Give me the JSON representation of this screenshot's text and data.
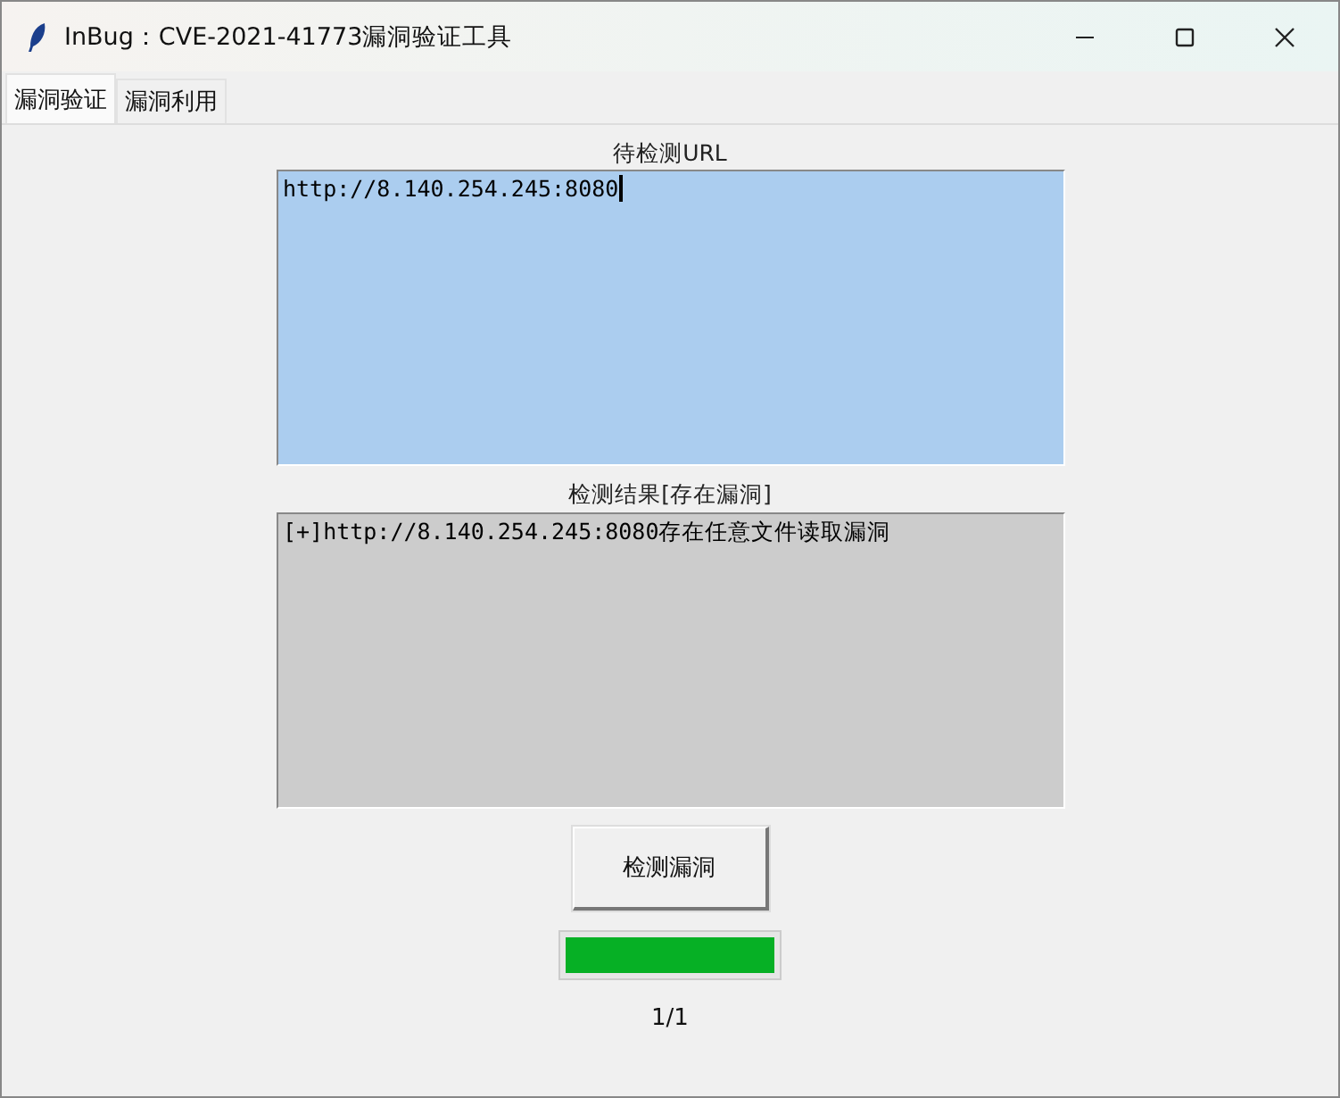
{
  "window": {
    "title": "InBug：CVE-2021-41773漏洞验证工具"
  },
  "tabs": [
    {
      "label": "漏洞验证",
      "selected": true
    },
    {
      "label": "漏洞利用",
      "selected": false
    }
  ],
  "url_section": {
    "label": "待检测URL",
    "value": "http://8.140.254.245:8080"
  },
  "result_section": {
    "label": "检测结果[存在漏洞]",
    "value": "[+]http://8.140.254.245:8080存在任意文件读取漏洞"
  },
  "check_button": {
    "label": "检测漏洞"
  },
  "progress": {
    "level": 1,
    "count": "1/1"
  }
}
